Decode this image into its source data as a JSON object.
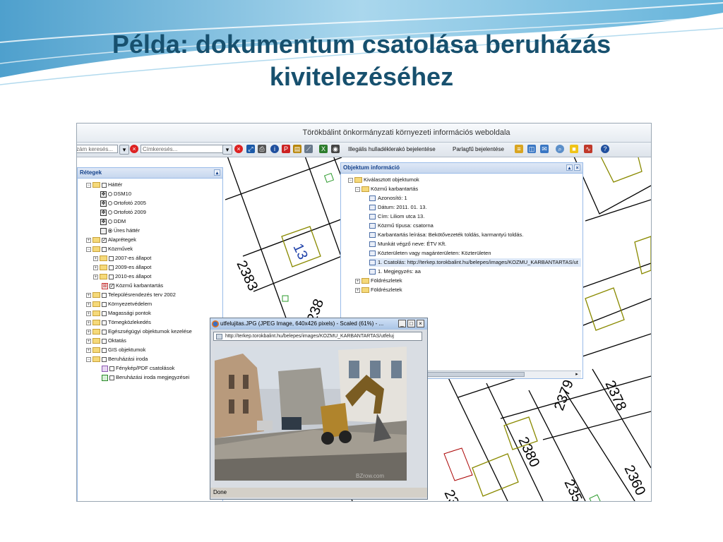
{
  "slide": {
    "title": "Példa: dokumentum csatolása beruházás kivitelezéséhez"
  },
  "app": {
    "window_title": "Törökbálint önkormányzati környezeti információs weboldala"
  },
  "toolbar": {
    "address_search_placeholder": "zám keresés...",
    "tag_search_placeholder": "Címkeresés...",
    "illegal_dump_report": "Illegális hulladéklerakó bejelentése",
    "ragweed_report": "Parlagfű bejelentése"
  },
  "layers": {
    "title": "Rétegek",
    "items": [
      {
        "label": "Háttér"
      },
      {
        "label": "DSM10"
      },
      {
        "label": "Ortofotó 2005"
      },
      {
        "label": "Ortofotó 2009"
      },
      {
        "label": "DDM"
      },
      {
        "label": "Üres háttér"
      },
      {
        "label": "Alaprétegek"
      },
      {
        "label": "Közművek"
      },
      {
        "label": "2007-es állapot"
      },
      {
        "label": "2009-es állapot"
      },
      {
        "label": "2010-es állapot"
      },
      {
        "label": "Közmű karbantartás"
      },
      {
        "label": "Településrendezés terv 2002"
      },
      {
        "label": "Környezetvédelem"
      },
      {
        "label": "Magassági pontok"
      },
      {
        "label": "Tömegközlekedés"
      },
      {
        "label": "Egészségügyi objektumok kezelése"
      },
      {
        "label": "Oktatás"
      },
      {
        "label": "GIS objektumok"
      },
      {
        "label": "Beruházási iroda"
      },
      {
        "label": "Fénykép/PDF csatolások"
      },
      {
        "label": "Beruházási iroda megjegyzései"
      }
    ]
  },
  "object_info": {
    "title": "Objektum információ",
    "items": [
      {
        "label": "Kiválasztott objektumok"
      },
      {
        "label": "Közmű karbantartás"
      },
      {
        "label": "Azonosító: 1"
      },
      {
        "label": "Dátum: 2011. 01. 13."
      },
      {
        "label": "Cím: Liliom utca 13."
      },
      {
        "label": "Közmű típusa: csatorna"
      },
      {
        "label": "Karbantartás leírása: Bekötővezeték toldás, karmantyú toldás."
      },
      {
        "label": "Munkát végző neve: ÉTV Kft."
      },
      {
        "label": "Közterületen vagy magánterületen: Közterületen"
      },
      {
        "label": "1. Csatolás: http://terkep.torokbalint.hu/belepes/images/KOZMU_KARBANTARTAS/ut"
      },
      {
        "label": "1. Megjegyzés: aa"
      },
      {
        "label": "Földrészletek"
      },
      {
        "label": "Földrészletek"
      }
    ]
  },
  "image_window": {
    "title": "utfelujitas.JPG (JPEG Image, 640x426 pixels) - Scaled (61%) - ...",
    "url": "http://terkep.torokbalint.hu/belepes/images/KOZMU_KARBANTARTAS/utfeluj",
    "status": "Done"
  },
  "map": {
    "parcel_labels": [
      "2383",
      "13",
      "238",
      "2378",
      "2379",
      "2380",
      "2360",
      "235",
      "23"
    ]
  },
  "colors": {
    "title": "#17506e",
    "panel_header": "#c7d7ee",
    "parcel_outline": "#8a8a00"
  }
}
